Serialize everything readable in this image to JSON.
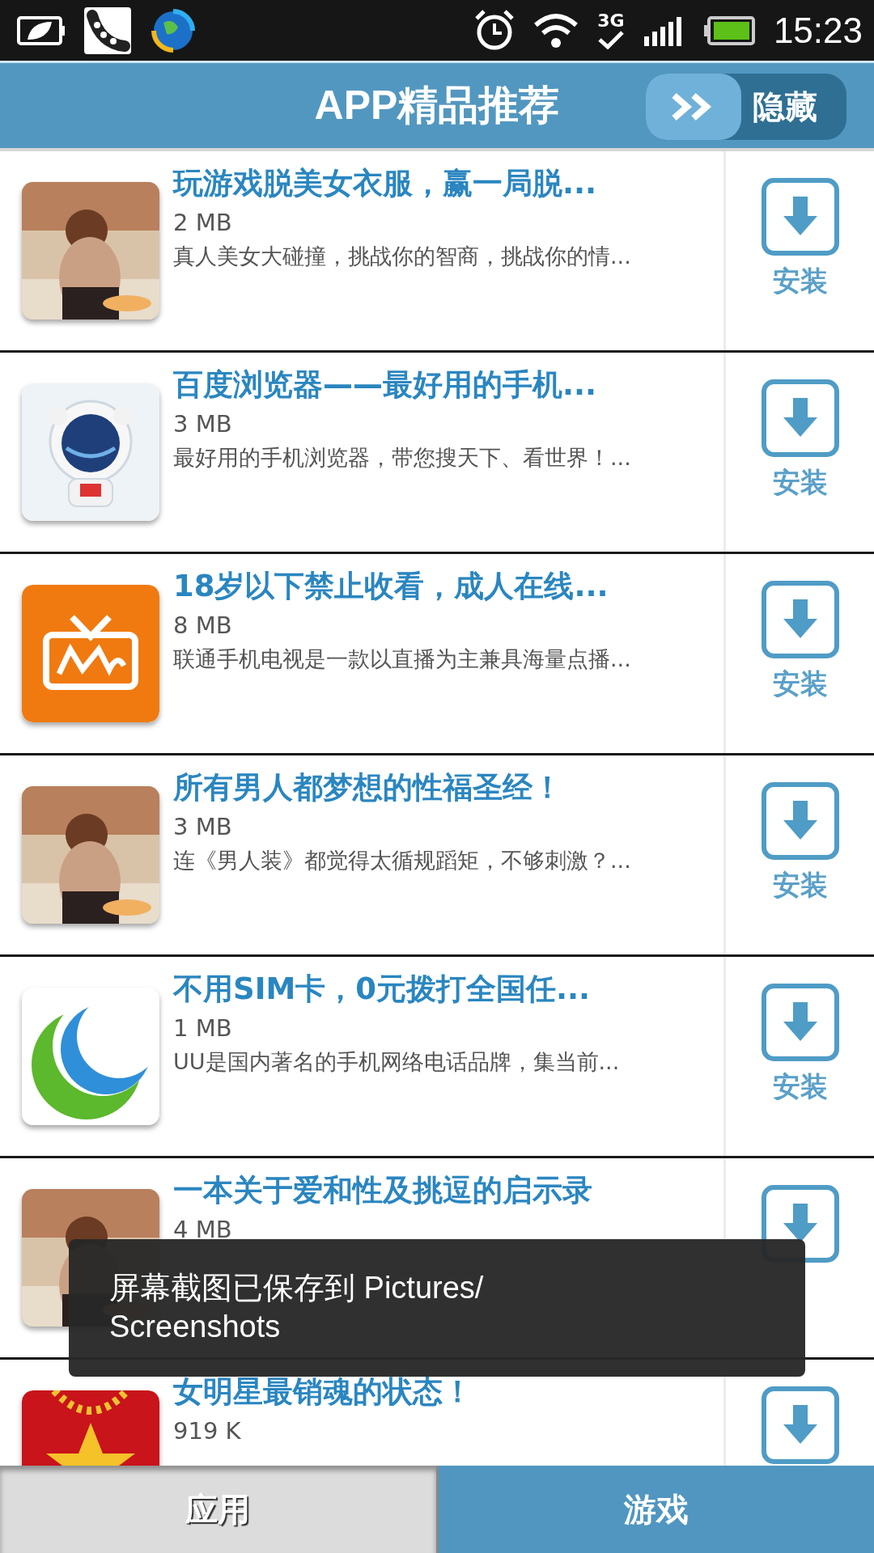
{
  "status_bar": {
    "network": "3G",
    "time": "15:23"
  },
  "header": {
    "title": "APP精品推荐",
    "hide_button": "隐藏"
  },
  "apps": [
    {
      "title": "玩游戏脱美女衣服，赢一局脱...",
      "size": "2 MB",
      "description": "真人美女大碰撞，挑战你的智商，挑战你的情...",
      "install_label": "安装"
    },
    {
      "kind": "astronaut",
      "title": "百度浏览器——最好用的手机...",
      "size": "3 MB",
      "description": "最好用的手机浏览器，带您搜天下、看世界！...",
      "install_label": "安装"
    },
    {
      "kind": "tv",
      "title": "18岁以下禁止收看，成人在线...",
      "size": "8 MB",
      "description": "联通手机电视是一款以直播为主兼具海量点播...",
      "install_label": "安装"
    },
    {
      "title": "所有男人都梦想的性福圣经！",
      "size": "3 MB",
      "description": "连《男人装》都觉得太循规蹈矩，不够刺激？...",
      "install_label": "安装"
    },
    {
      "kind": "crescent",
      "title": "不用SIM卡，0元拨打全国任...",
      "size": "1 MB",
      "description": "UU是国内著名的手机网络电话品牌，集当前...",
      "install_label": "安装"
    },
    {
      "title": "一本关于爱和性及挑逗的启示录",
      "size": "4 MB"
    },
    {
      "kind": "star",
      "title": "女明星最销魂的状态！",
      "size": "919 K"
    }
  ],
  "toast": "屏幕截图已保存到 Pictures/ Screenshots",
  "tabs": [
    {
      "label": "应用",
      "selected": false
    },
    {
      "label": "游戏",
      "selected": true
    }
  ]
}
